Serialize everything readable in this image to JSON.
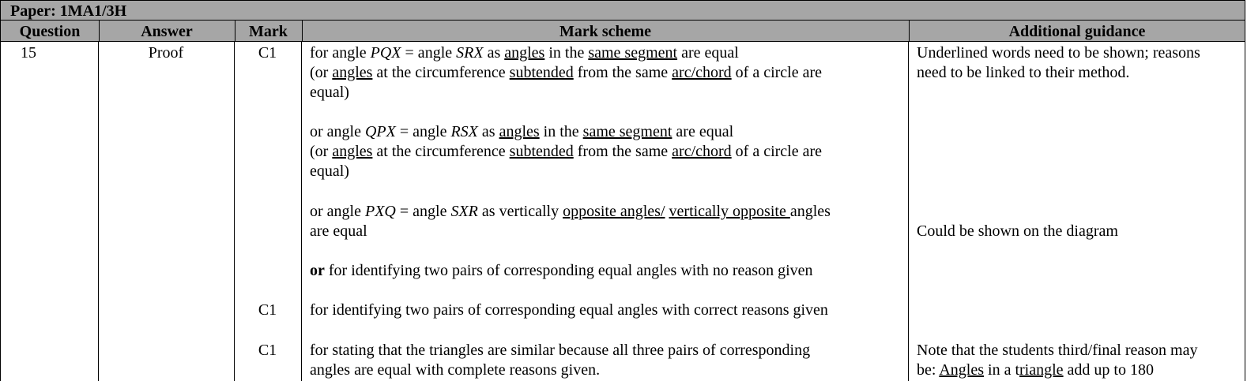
{
  "paper": {
    "title": "Paper: 1MA1/3H"
  },
  "headers": {
    "question": "Question",
    "answer": "Answer",
    "mark": "Mark",
    "mark_scheme": "Mark scheme",
    "additional_guidance": "Additional guidance"
  },
  "row": {
    "question": "15",
    "answer": "Proof",
    "marks": [
      "C1",
      "C1",
      "C1"
    ],
    "scheme": {
      "b1": {
        "l1": [
          "for angle ",
          "PQX",
          " = angle ",
          "SRX",
          " as ",
          "angles",
          " in the ",
          "same segment",
          " are equal"
        ],
        "l2": [
          "(or ",
          "angles",
          " at the circumference ",
          "subtended",
          " from the same ",
          "arc/chord",
          " of a circle are"
        ],
        "l3": "equal)"
      },
      "b2": {
        "l1": [
          "or angle ",
          "QPX",
          " = angle ",
          "RSX",
          " as ",
          "angles",
          " in the ",
          "same segment",
          " are equal"
        ],
        "l2": [
          "(or ",
          "angles",
          " at the circumference ",
          "subtended",
          " from the same ",
          "arc/chord",
          " of a circle are"
        ],
        "l3": "equal)"
      },
      "b3": {
        "l1": [
          "or angle ",
          "PXQ",
          " = angle ",
          "SXR",
          " as vertically ",
          "opposite angles/",
          " ",
          "vertically opposite ",
          "angles"
        ],
        "l2": "are equal"
      },
      "b4": [
        "or",
        " for identifying two pairs of corresponding equal angles with no reason given"
      ],
      "b5": "for identifying two pairs of corresponding equal angles with correct reasons given",
      "b6": {
        "l1": "for stating that the triangles are similar because all three pairs of corresponding",
        "l2": "angles are equal with complete reasons given."
      }
    },
    "guidance": {
      "g1": {
        "l1": "Underlined words need to be shown; reasons",
        "l2": "need to be linked to their method."
      },
      "g2": "Could be shown on the diagram",
      "g3": {
        "l1": "Note that the students third/final reason may",
        "l2": [
          "be: ",
          "Angles",
          " in a t",
          "riangle",
          " add up to 180"
        ]
      }
    }
  }
}
